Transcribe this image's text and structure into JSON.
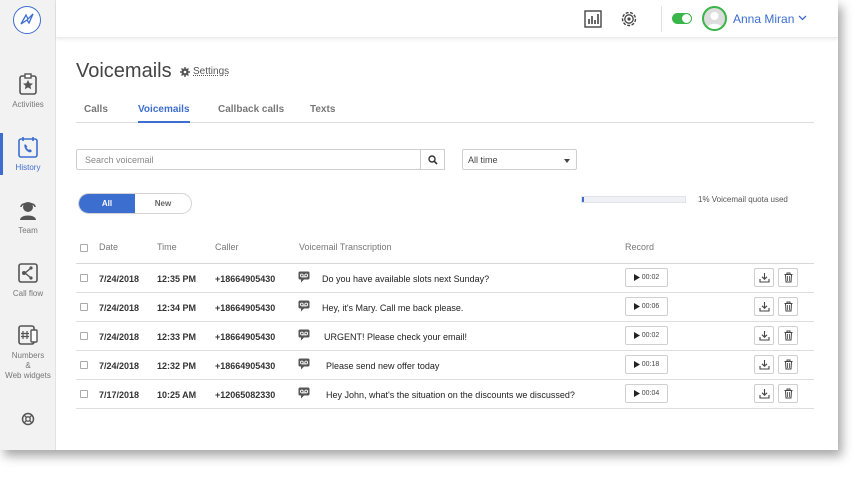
{
  "sidebar": {
    "logo": "logo-icon",
    "items": [
      {
        "label": "Activities",
        "icon": "star-clipboard-icon"
      },
      {
        "label": "History",
        "icon": "phone-history-icon",
        "active": true
      },
      {
        "label": "Team",
        "icon": "headset-agent-icon"
      },
      {
        "label": "Call flow",
        "icon": "call-flow-icon"
      },
      {
        "label": "Numbers & Web widgets",
        "line1": "Numbers",
        "line2": "&",
        "line3": "Web widgets",
        "icon": "numbers-icon"
      }
    ],
    "help_icon": "lifebuoy-icon"
  },
  "topbar": {
    "user_name": "Anna Miran",
    "toggle_on": true
  },
  "page": {
    "title": "Voicemails",
    "settings_label": "Settings"
  },
  "tabs": [
    "Calls",
    "Voicemails",
    "Callback calls",
    "Texts"
  ],
  "filters": {
    "search_placeholder": "Search voicemail",
    "time_select": "All time",
    "segment": [
      "All",
      "New"
    ],
    "quota_fraction": 0.01,
    "quota_text": "1% Voicemail quota used"
  },
  "table": {
    "headers": {
      "date": "Date",
      "time": "Time",
      "caller": "Caller",
      "transcription": "Voicemail Transcription",
      "record": "Record"
    },
    "rows": [
      {
        "date": "7/24/2018",
        "time": "12:35 PM",
        "caller": "+18664905430",
        "transcription": "Do you have available slots next Sunday?",
        "duration": "00:02"
      },
      {
        "date": "7/24/2018",
        "time": "12:34 PM",
        "caller": "+18664905430",
        "transcription": "Hey, it's Mary. Call me back please.",
        "duration": "00:06"
      },
      {
        "date": "7/24/2018",
        "time": "12:33 PM",
        "caller": "+18664905430",
        "transcription": "URGENT! Please check your email!",
        "duration": "00:02"
      },
      {
        "date": "7/24/2018",
        "time": "12:32 PM",
        "caller": "+18664905430",
        "transcription": "Please send new offer today",
        "duration": "00:18"
      },
      {
        "date": "7/17/2018",
        "time": "10:25 AM",
        "caller": "+12065082330",
        "transcription": "Hey John, what's the situation on the discounts we discussed?",
        "duration": "00:04"
      }
    ]
  },
  "colors": {
    "accent": "#3c6ed0",
    "green": "#39b54a"
  }
}
